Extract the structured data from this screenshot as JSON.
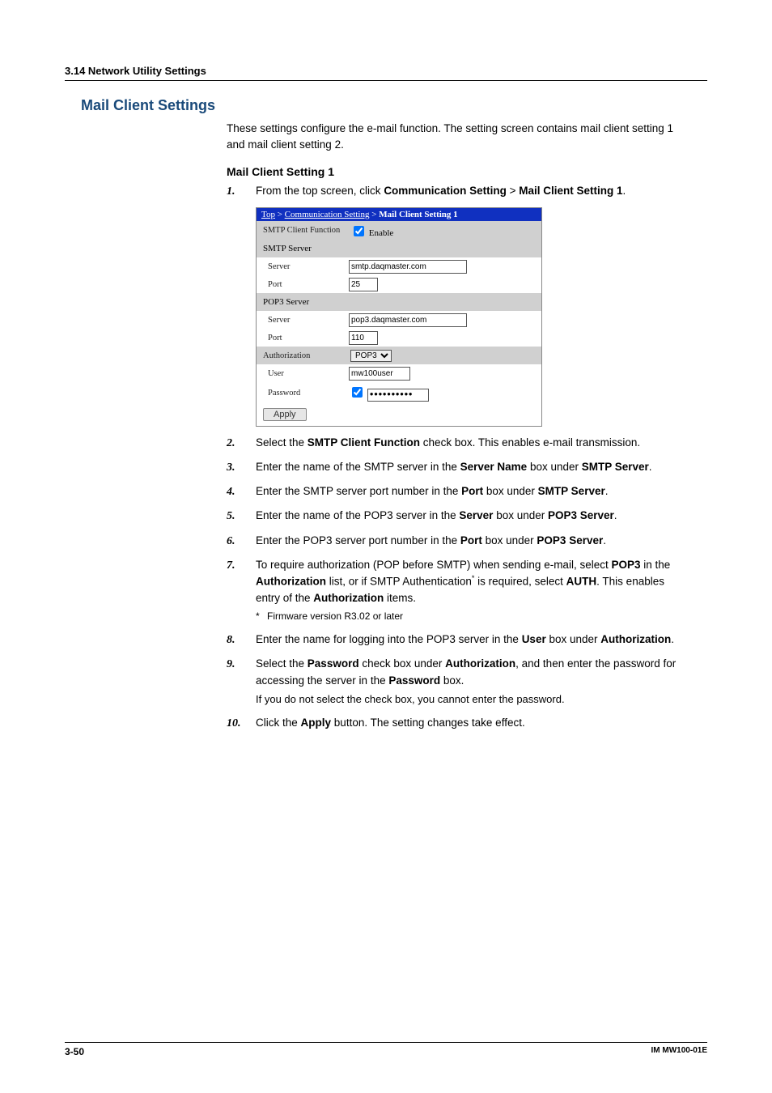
{
  "header": {
    "section_label": "3.14  Network Utility Settings"
  },
  "main": {
    "title": "Mail Client Settings",
    "intro": "These settings configure the e-mail function. The setting screen contains mail client setting 1 and mail client setting 2.",
    "sub_title": "Mail Client Setting 1"
  },
  "steps": {
    "s1_pre": "From the top screen, click ",
    "s1_b1": "Communication Setting",
    "s1_gt": " > ",
    "s1_b2": "Mail Client Setting 1",
    "s1_post": ".",
    "s2_pre": "Select the ",
    "s2_b": "SMTP Client Function",
    "s2_post": " check box. This enables e-mail transmission.",
    "s3_pre": "Enter the name of the SMTP server in the ",
    "s3_b1": "Server Name",
    "s3_mid": " box under ",
    "s3_b2": "SMTP Server",
    "s3_post": ".",
    "s4_pre": "Enter the SMTP server port number in the ",
    "s4_b1": "Port",
    "s4_mid": " box under ",
    "s4_b2": "SMTP Server",
    "s4_post": ".",
    "s5_pre": "Enter the name of the POP3 server in the ",
    "s5_b1": "Server",
    "s5_mid": " box under ",
    "s5_b2": "POP3 Server",
    "s5_post": ".",
    "s6_pre": "Enter the POP3 server port number in the ",
    "s6_b1": "Port",
    "s6_mid": " box under ",
    "s6_b2": "POP3 Server",
    "s6_post": ".",
    "s7_pre": "To require authorization (POP before SMTP) when sending e-mail, select ",
    "s7_b1": "POP3",
    "s7_mid1": " in the ",
    "s7_b2": "Authorization",
    "s7_mid2": " list, or if SMTP Authentication",
    "s7_sup": "*",
    "s7_mid3": " is required, select ",
    "s7_b3": "AUTH",
    "s7_mid4": ". This enables entry of the ",
    "s7_b4": "Authorization",
    "s7_post": " items.",
    "s7_note": "Firmware version R3.02 or later",
    "s8_pre": "Enter the name for logging into the POP3 server in the ",
    "s8_b1": "User",
    "s8_mid": " box under ",
    "s8_b2": "Authorization",
    "s8_post": ".",
    "s9_pre": "Select the ",
    "s9_b1": "Password",
    "s9_mid1": " check box under ",
    "s9_b2": "Authorization",
    "s9_mid2": ", and then enter the password for accessing the server in the ",
    "s9_b3": "Password",
    "s9_post": " box.",
    "s9_note": "If you do not select the check box, you cannot enter the password.",
    "s10_pre": "Click the ",
    "s10_b": "Apply",
    "s10_post": " button. The setting changes take effect."
  },
  "form": {
    "breadcrumb_top": "Top",
    "breadcrumb_sep": " > ",
    "breadcrumb_comm": "Communication Setting",
    "breadcrumb_page": "Mail Client Setting 1",
    "row_smtp_client": "SMTP Client Function",
    "enable_label": "Enable",
    "section_smtp": "SMTP Server",
    "lbl_server": "Server",
    "lbl_port": "Port",
    "smtp_server": "smtp.daqmaster.com",
    "smtp_port": "25",
    "section_pop3": "POP3 Server",
    "pop3_server": "pop3.daqmaster.com",
    "pop3_port": "110",
    "section_auth": "Authorization",
    "auth_option": "POP3",
    "lbl_user": "User",
    "user_val": "mw100user",
    "lbl_password": "Password",
    "pw_val": "●●●●●●●●●●",
    "apply": "Apply"
  },
  "nums": {
    "n1": "1.",
    "n2": "2.",
    "n3": "3.",
    "n4": "4.",
    "n5": "5.",
    "n6": "6.",
    "n7": "7.",
    "n8": "8.",
    "n9": "9.",
    "n10": "10."
  },
  "footer": {
    "page": "3-50",
    "doc": "IM MW100-01E"
  }
}
